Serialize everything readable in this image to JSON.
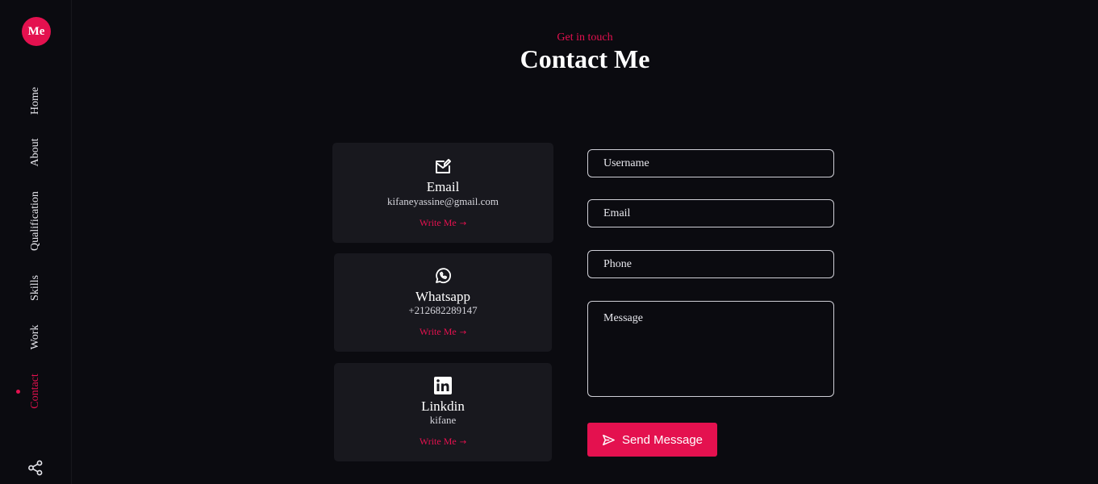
{
  "sidebar": {
    "logo": "Me",
    "nav": [
      "Home",
      "About",
      "Qualification",
      "Skills",
      "Work",
      "Contact"
    ],
    "active": "Contact"
  },
  "header": {
    "subtitle": "Get in touch",
    "title": "Contact Me"
  },
  "cards": [
    {
      "icon": "mail-edit-icon",
      "title": "Email",
      "value": "kifaneyassine@gmail.com",
      "link": "Write Me"
    },
    {
      "icon": "whatsapp-icon",
      "title": "Whatsapp",
      "value": "+212682289147",
      "link": "Write Me"
    },
    {
      "icon": "linkedin-icon",
      "title": "Linkdin",
      "value": "kifane",
      "link": "Write Me"
    }
  ],
  "form": {
    "username_placeholder": "Username",
    "email_placeholder": "Email",
    "phone_placeholder": "Phone",
    "message_placeholder": "Message",
    "submit_label": "Send Message"
  },
  "colors": {
    "accent": "#e4114f",
    "background": "#0b0b10",
    "card": "#18181e"
  }
}
